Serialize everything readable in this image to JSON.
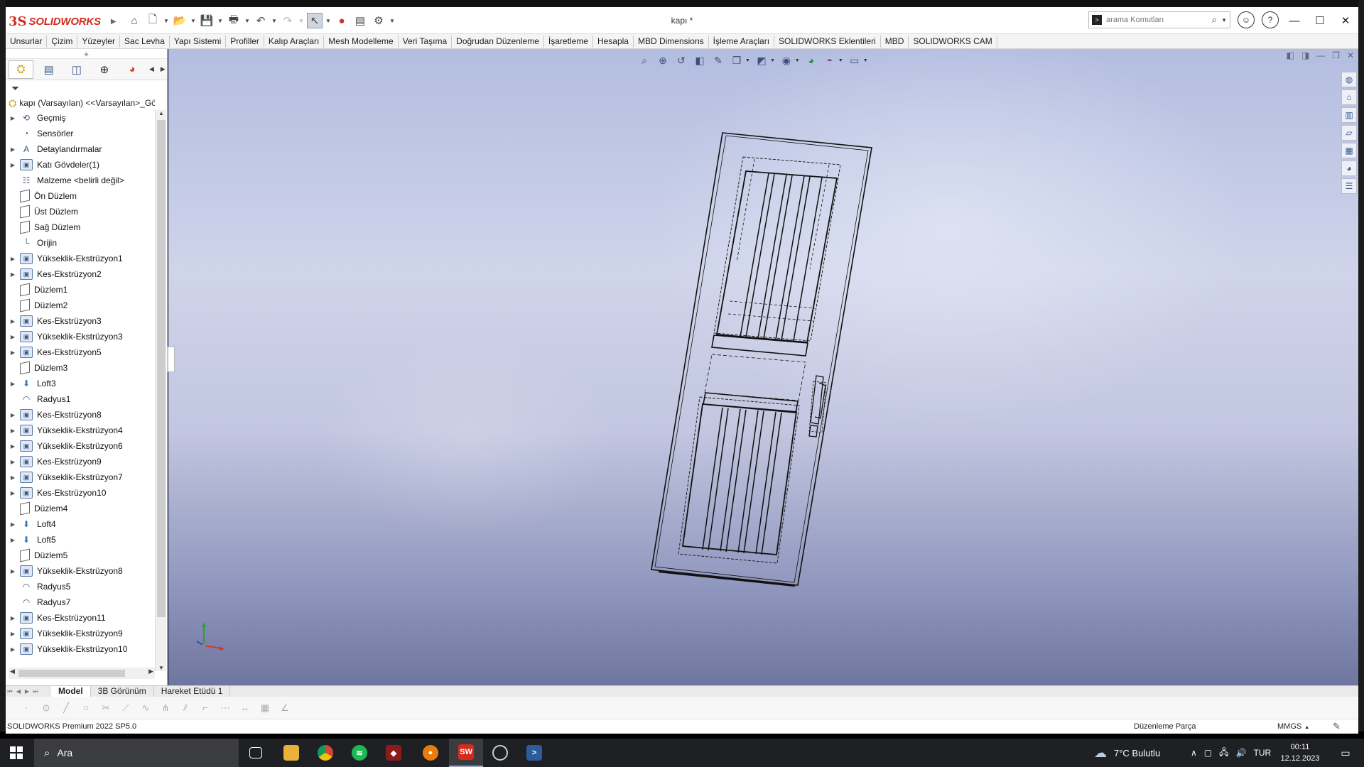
{
  "app": {
    "brand_ds": "3S",
    "brand_name": "SOLIDWORKS",
    "document_title": "kapı *",
    "search_placeholder": "arama Komutları"
  },
  "command_tabs": [
    "Unsurlar",
    "Çizim",
    "Yüzeyler",
    "Sac Levha",
    "Yapı Sistemi",
    "Profiller",
    "Kalıp Araçları",
    "Mesh Modelleme",
    "Veri Taşıma",
    "Doğrudan Düzenleme",
    "İşaretleme",
    "Hesapla",
    "MBD Dimensions",
    "İşleme Araçları",
    "SOLIDWORKS Eklentileri",
    "MBD",
    "SOLIDWORKS CAM"
  ],
  "feature_tree": {
    "root": "kapı (Varsayılan) <<Varsayılan>_Gö",
    "items": [
      {
        "label": "Geçmiş",
        "icon": "history-icon",
        "expandable": true
      },
      {
        "label": "Sensörler",
        "icon": "sensor-icon",
        "expandable": false
      },
      {
        "label": "Detaylandırmalar",
        "icon": "annotation-icon",
        "expandable": true
      },
      {
        "label": "Katı Gövdeler(1)",
        "icon": "solid-bodies-icon",
        "expandable": true
      },
      {
        "label": "Malzeme <belirli değil>",
        "icon": "material-icon",
        "expandable": false
      },
      {
        "label": "Ön Düzlem",
        "icon": "plane-icon",
        "expandable": false
      },
      {
        "label": "Üst Düzlem",
        "icon": "plane-icon",
        "expandable": false
      },
      {
        "label": "Sağ Düzlem",
        "icon": "plane-icon",
        "expandable": false
      },
      {
        "label": "Orijin",
        "icon": "origin-icon",
        "expandable": false
      },
      {
        "label": "Yükseklik-Ekstrüzyon1",
        "icon": "boss-extrude-icon",
        "expandable": true
      },
      {
        "label": "Kes-Ekstrüzyon2",
        "icon": "cut-extrude-icon",
        "expandable": true
      },
      {
        "label": "Düzlem1",
        "icon": "plane-icon",
        "expandable": false
      },
      {
        "label": "Düzlem2",
        "icon": "plane-icon",
        "expandable": false
      },
      {
        "label": "Kes-Ekstrüzyon3",
        "icon": "cut-extrude-icon",
        "expandable": true
      },
      {
        "label": "Yükseklik-Ekstrüzyon3",
        "icon": "boss-extrude-icon",
        "expandable": true
      },
      {
        "label": "Kes-Ekstrüzyon5",
        "icon": "cut-extrude-icon",
        "expandable": true
      },
      {
        "label": "Düzlem3",
        "icon": "plane-icon",
        "expandable": false
      },
      {
        "label": "Loft3",
        "icon": "loft-icon",
        "expandable": true
      },
      {
        "label": "Radyus1",
        "icon": "fillet-icon",
        "expandable": false
      },
      {
        "label": "Kes-Ekstrüzyon8",
        "icon": "cut-extrude-icon",
        "expandable": true
      },
      {
        "label": "Yükseklik-Ekstrüzyon4",
        "icon": "boss-extrude-icon",
        "expandable": true
      },
      {
        "label": "Yükseklik-Ekstrüzyon6",
        "icon": "boss-extrude-icon",
        "expandable": true
      },
      {
        "label": "Kes-Ekstrüzyon9",
        "icon": "cut-extrude-icon",
        "expandable": true
      },
      {
        "label": "Yükseklik-Ekstrüzyon7",
        "icon": "boss-extrude-icon",
        "expandable": true
      },
      {
        "label": "Kes-Ekstrüzyon10",
        "icon": "cut-extrude-icon",
        "expandable": true
      },
      {
        "label": "Düzlem4",
        "icon": "plane-icon",
        "expandable": false
      },
      {
        "label": "Loft4",
        "icon": "loft-icon",
        "expandable": true
      },
      {
        "label": "Loft5",
        "icon": "loft-icon",
        "expandable": true
      },
      {
        "label": "Düzlem5",
        "icon": "plane-icon",
        "expandable": false
      },
      {
        "label": "Yükseklik-Ekstrüzyon8",
        "icon": "boss-extrude-icon",
        "expandable": true
      },
      {
        "label": "Radyus5",
        "icon": "fillet-icon",
        "expandable": false
      },
      {
        "label": "Radyus7",
        "icon": "fillet-icon",
        "expandable": false
      },
      {
        "label": "Kes-Ekstrüzyon11",
        "icon": "cut-extrude-icon",
        "expandable": true
      },
      {
        "label": "Yükseklik-Ekstrüzyon9",
        "icon": "boss-extrude-icon",
        "expandable": true
      },
      {
        "label": "Yükseklik-Ekstrüzyon10",
        "icon": "boss-extrude-icon",
        "expandable": true
      }
    ]
  },
  "bottom_tabs": [
    "Model",
    "3B Görünüm",
    "Hareket Etüdü 1"
  ],
  "status": {
    "product": "SOLIDWORKS Premium 2022 SP5.0",
    "mode": "Düzenleme Parça",
    "units": "MMGS"
  },
  "taskbar": {
    "search_label": "Ara",
    "weather": "7°C Bulutlu",
    "language": "TUR",
    "time": "00:11",
    "date": "12.12.2023"
  },
  "colors": {
    "brand_red": "#d52b1e",
    "viewport_top": "#b3bde0",
    "viewport_bottom": "#6f769f",
    "taskbar": "#1f2024"
  }
}
